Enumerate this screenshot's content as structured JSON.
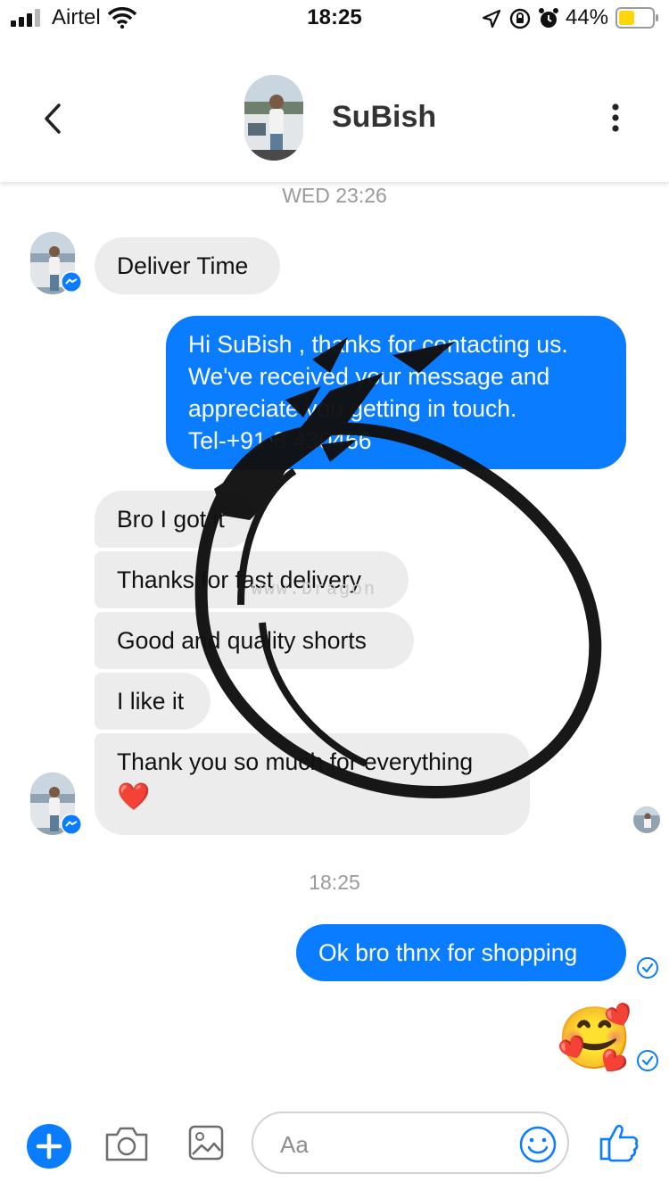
{
  "status_bar": {
    "carrier": "Airtel",
    "time": "18:25",
    "battery_percent": "44%"
  },
  "header": {
    "contact_name": "SuBish"
  },
  "conversation": {
    "timestamp_1": "WED 23:26",
    "msg_deliver_time": "Deliver Time",
    "msg_reply_lines": [
      "Hi SuBish , thanks for contacting us.",
      "We've received your message and",
      "appreciate you getting in touch.",
      "Tel-+91 8 430466"
    ],
    "msg_got_it": "Bro I got it",
    "msg_fast_delivery": "Thanks for fast delivery",
    "msg_quality": "Good and quality shorts",
    "msg_like": "I like it",
    "msg_thank_you": "Thank you so much for everything",
    "msg_thank_you_emoji": "❤️",
    "timestamp_2": "18:25",
    "msg_ok_bro": "Ok bro thnx for shopping",
    "msg_emoji": "🥰"
  },
  "composer": {
    "placeholder": "Aa"
  },
  "watermark": {
    "text": "www.Dragon"
  },
  "colors": {
    "accent": "#0a7cff",
    "incoming_bubble": "#ececec"
  },
  "icons": [
    "signal-icon",
    "wifi-icon",
    "location-icon",
    "rotation-lock-icon",
    "alarm-icon",
    "battery-icon",
    "back-chevron-icon",
    "more-vertical-icon",
    "messenger-badge-icon",
    "read-receipt-icon",
    "plus-icon",
    "camera-icon",
    "gallery-icon",
    "smiley-icon",
    "thumbs-up-icon"
  ]
}
